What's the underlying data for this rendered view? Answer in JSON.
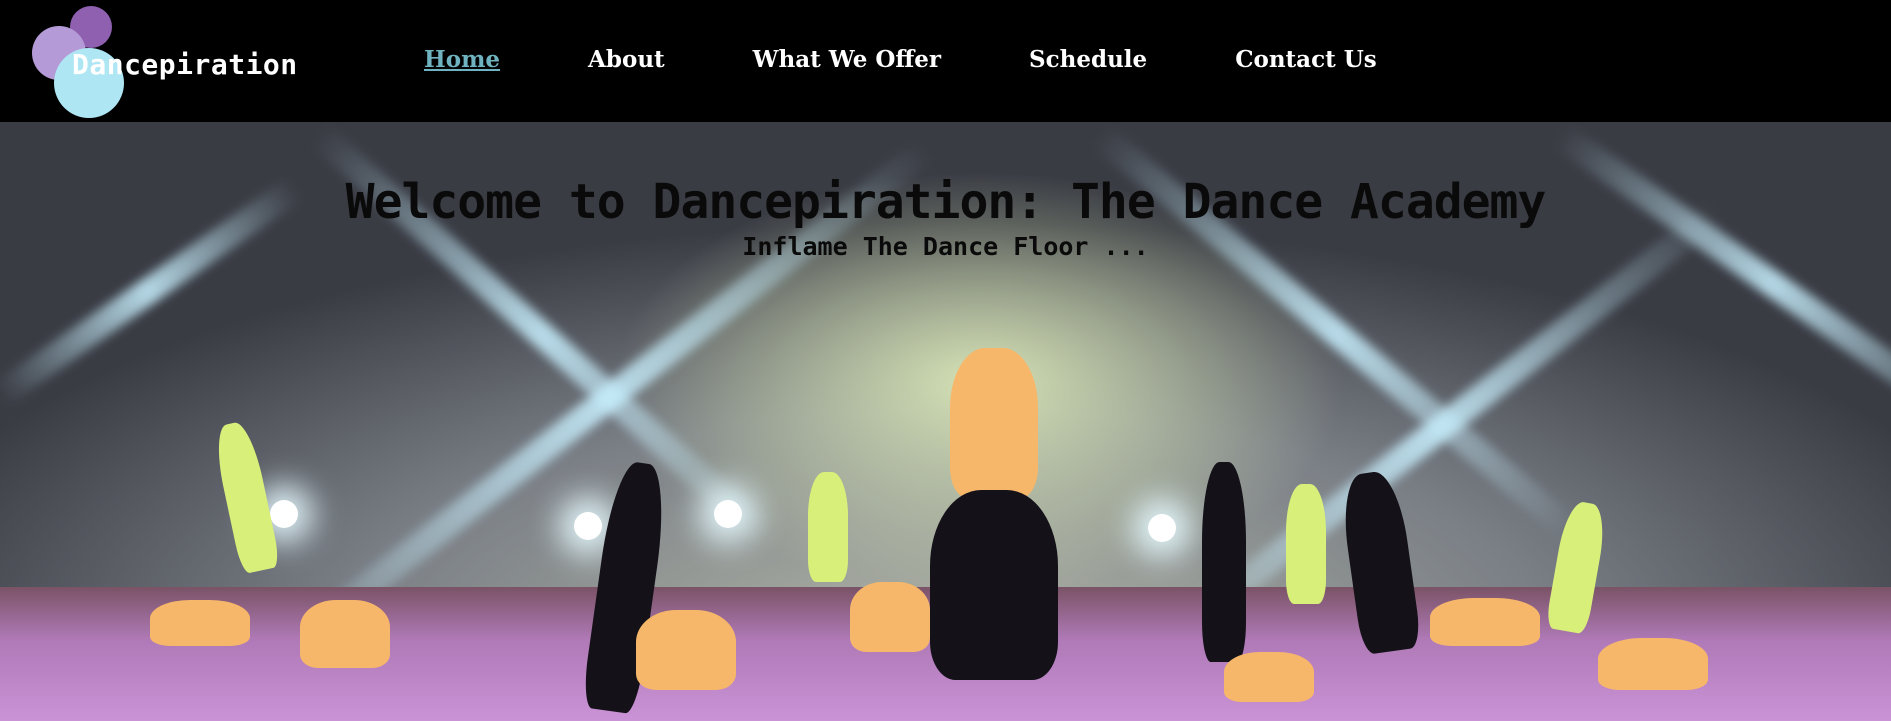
{
  "brand": {
    "name": "Dancepiration",
    "colors": {
      "circle_dark": "#8f5fb0",
      "circle_light": "#b59ad8",
      "circle_cyan": "#aee6f3"
    }
  },
  "nav": {
    "items": [
      {
        "label": "Home",
        "active": true
      },
      {
        "label": "About",
        "active": false
      },
      {
        "label": "What We Offer",
        "active": false
      },
      {
        "label": "Schedule",
        "active": false
      },
      {
        "label": "Contact Us",
        "active": false
      }
    ],
    "active_color": "#6fb3c0"
  },
  "hero": {
    "title": "Welcome to Dancepiration: The Dance Academy",
    "subtitle": "Inflame The Dance Floor ..."
  }
}
